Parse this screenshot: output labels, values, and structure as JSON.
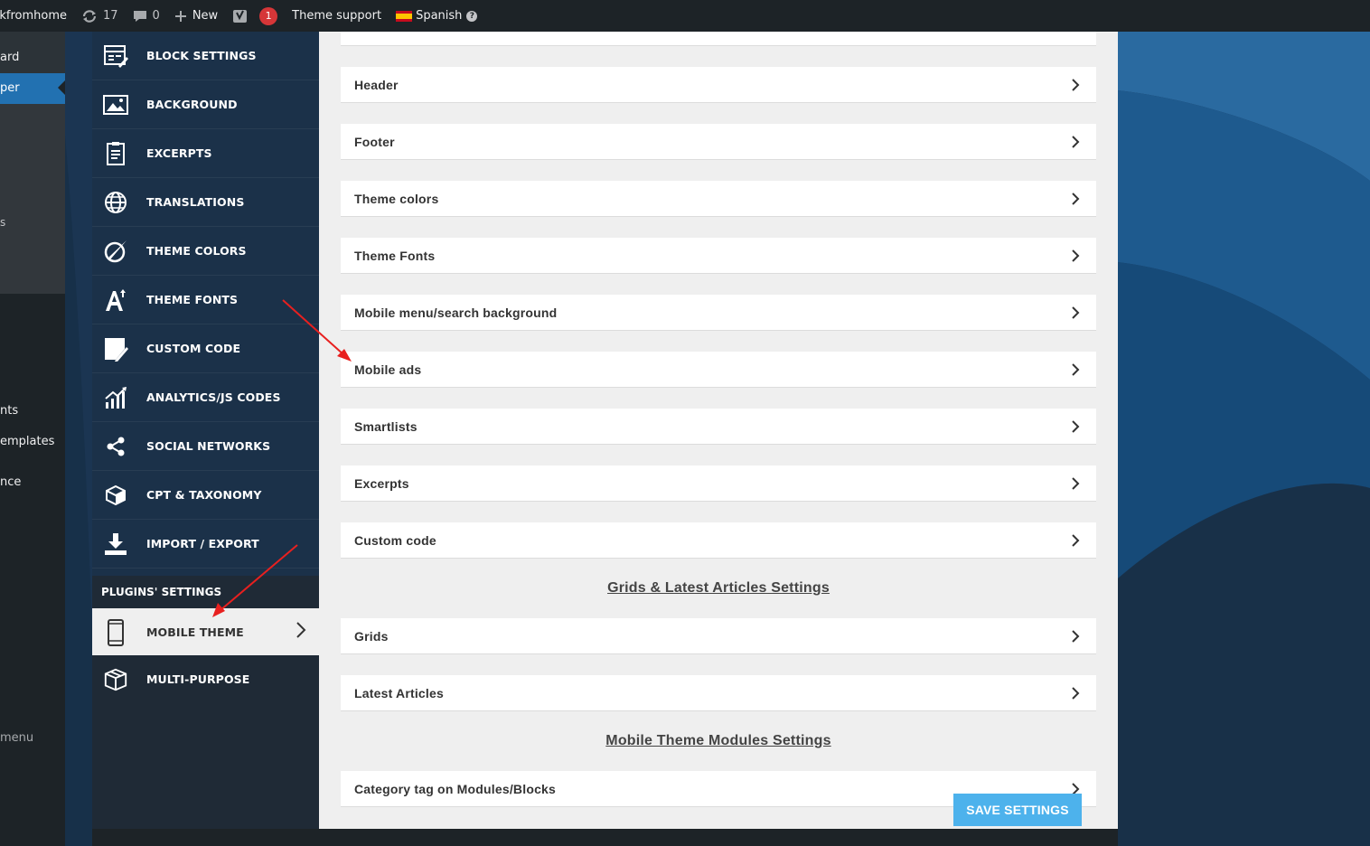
{
  "admin_bar": {
    "site_name": "rkfromhome",
    "updates_count": "17",
    "comments_count": "0",
    "new_label": "New",
    "yoast_badge": "1",
    "theme_support_label": "Theme support",
    "language_label": "Spanish"
  },
  "wp_menu": {
    "items": [
      {
        "label": "ard"
      },
      {
        "label": "per"
      },
      {
        "label": "s"
      },
      {
        "label": "nts"
      },
      {
        "label": "emplates"
      },
      {
        "label": "nce"
      },
      {
        "label": "menu"
      }
    ]
  },
  "theme_nav": {
    "items": [
      {
        "label": "BLOCK SETTINGS",
        "icon": "block-settings-icon"
      },
      {
        "label": "BACKGROUND",
        "icon": "image-icon"
      },
      {
        "label": "EXCERPTS",
        "icon": "document-icon"
      },
      {
        "label": "TRANSLATIONS",
        "icon": "globe-icon"
      },
      {
        "label": "THEME COLORS",
        "icon": "palette-icon"
      },
      {
        "label": "THEME FONTS",
        "icon": "font-icon"
      },
      {
        "label": "CUSTOM CODE",
        "icon": "code-pencil-icon"
      },
      {
        "label": "ANALYTICS/JS CODES",
        "icon": "analytics-icon"
      },
      {
        "label": "SOCIAL NETWORKS",
        "icon": "share-icon"
      },
      {
        "label": "CPT & TAXONOMY",
        "icon": "cube-icon"
      },
      {
        "label": "IMPORT / EXPORT",
        "icon": "download-icon"
      }
    ],
    "plugins_header": "PLUGINS' SETTINGS",
    "plugin_items": [
      {
        "label": "MOBILE THEME",
        "icon": "mobile-icon",
        "active": true
      },
      {
        "label": "MULTI-PURPOSE",
        "icon": "box-icon",
        "active": false
      }
    ]
  },
  "content": {
    "rows_top": [
      {
        "label": "Header"
      },
      {
        "label": "Footer"
      },
      {
        "label": "Theme colors"
      },
      {
        "label": "Theme Fonts"
      },
      {
        "label": "Mobile menu/search background"
      },
      {
        "label": "Mobile ads"
      },
      {
        "label": "Smartlists"
      },
      {
        "label": "Excerpts"
      },
      {
        "label": "Custom code"
      }
    ],
    "section_grids": "Grids & Latest Articles Settings",
    "rows_grids": [
      {
        "label": "Grids"
      },
      {
        "label": "Latest Articles"
      }
    ],
    "section_modules": "Mobile Theme Modules Settings",
    "rows_modules": [
      {
        "label": "Category tag on Modules/Blocks"
      }
    ],
    "save_label": "SAVE SETTINGS"
  },
  "colors": {
    "accent": "#4db2ec",
    "wp_active": "#2271b1",
    "admin_bar": "#1d2327",
    "annotation_arrow": "#e8201f"
  }
}
